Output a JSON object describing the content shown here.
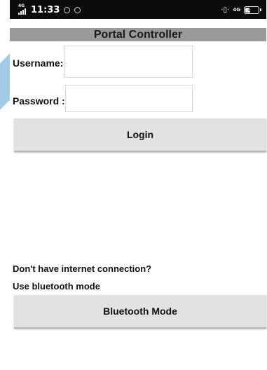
{
  "status_bar": {
    "network_type": "4G",
    "time": "11:33",
    "right_network_type": "4G",
    "battery_level": "42",
    "battery_fraction": 0.42
  },
  "app": {
    "title": "Portal Controller"
  },
  "login_form": {
    "username_label": "Username:",
    "username_value": "",
    "password_label": "Password :",
    "password_value": "",
    "login_label": "Login"
  },
  "bluetooth": {
    "question_text": "Don't have internet connection?",
    "hint_text": "Use bluetooth mode",
    "button_label": "Bluetooth Mode"
  },
  "colors": {
    "title_bar": "#9a9a9a",
    "button_bg": "#e2e2e2",
    "status_bar_bg": "#0c0c0c",
    "accent_stripe": "#56a0d6"
  },
  "icons": {
    "status_left": [
      "signal-icon",
      "whatsapp-icon",
      "whatsapp-icon"
    ],
    "status_right": [
      "vibrate-icon",
      "battery-icon"
    ]
  }
}
